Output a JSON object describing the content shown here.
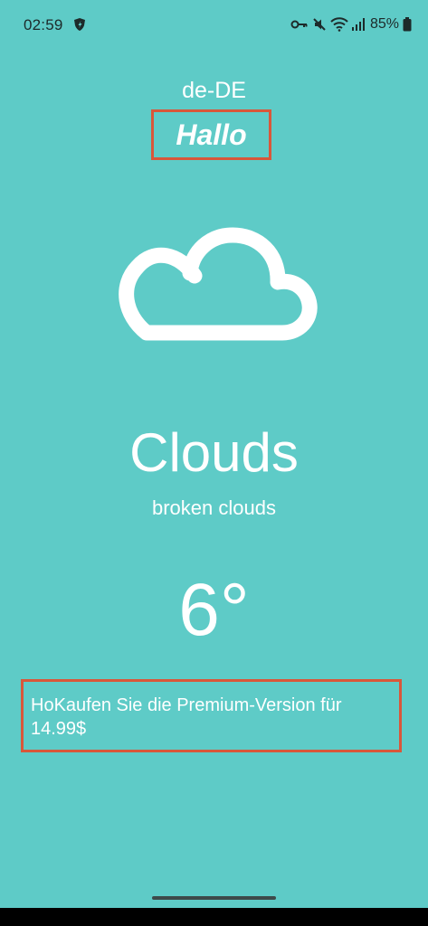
{
  "status_bar": {
    "time": "02:59",
    "battery": "85%",
    "icons": [
      "shield-app-icon",
      "key-icon",
      "mute-icon",
      "wifi-icon",
      "signal-icon",
      "battery-icon"
    ]
  },
  "locale": "de-DE",
  "greeting": "Hallo",
  "weather": {
    "icon": "cloud-icon",
    "condition": "Clouds",
    "description": "broken clouds",
    "temperature": "6°"
  },
  "premium": {
    "text": "HoKaufen Sie die Premium-Version für 14.99$"
  },
  "colors": {
    "background": "#5ECBC7",
    "highlight_border": "#D9573A",
    "text": "#FFFFFF"
  }
}
